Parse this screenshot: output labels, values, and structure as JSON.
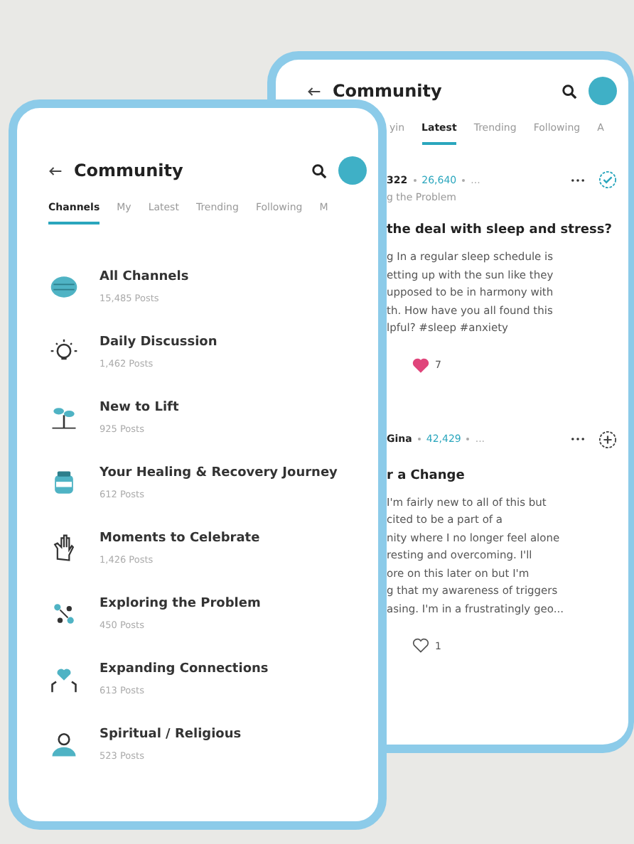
{
  "back_screen": {
    "title": "Community",
    "tabs": [
      {
        "label": "yin",
        "selected": false
      },
      {
        "label": "Latest",
        "selected": true
      },
      {
        "label": "Trending",
        "selected": false
      },
      {
        "label": "Following",
        "selected": false
      },
      {
        "label": "A",
        "selected": false
      }
    ],
    "posts": [
      {
        "author": "322",
        "points": "26,640",
        "time": "...",
        "category": "g the Problem",
        "title": "the deal with sleep and stress?",
        "body": [
          "g In a regular sleep schedule is",
          "etting up with the sun like they",
          "upposed to be in harmony with",
          "th. How have you all found this",
          "lpful? #sleep #anxiety"
        ],
        "liked": true,
        "likes": "7",
        "following": true
      },
      {
        "author": "Gina",
        "points": "42,429",
        "time": "...",
        "title": "r a Change",
        "body": [
          "I'm fairly new to all of this but",
          "cited to be a part of a",
          "nity where I no longer feel alone",
          "resting and overcoming. I'll",
          "ore on this later on but I'm",
          "g that my awareness of triggers",
          "asing. I'm in a frustratingly geo..."
        ],
        "liked": false,
        "likes": "1",
        "following": false
      }
    ]
  },
  "front_screen": {
    "title": "Community",
    "tabs": [
      {
        "label": "Channels",
        "selected": true
      },
      {
        "label": "My",
        "selected": false
      },
      {
        "label": "Latest",
        "selected": false
      },
      {
        "label": "Trending",
        "selected": false
      },
      {
        "label": "Following",
        "selected": false
      },
      {
        "label": "M",
        "selected": false
      }
    ],
    "channels": [
      {
        "kind": "globe",
        "name": "All Channels",
        "posts": "15,485 Posts"
      },
      {
        "kind": "bulb",
        "name": "Daily Discussion",
        "posts": "1,462 Posts"
      },
      {
        "kind": "sprout",
        "name": "New to Lift",
        "posts": "925 Posts"
      },
      {
        "kind": "jar",
        "name": "Your Healing & Recovery Journey",
        "posts": "612 Posts"
      },
      {
        "kind": "hand",
        "name": "Moments to Celebrate",
        "posts": "1,426 Posts"
      },
      {
        "kind": "dots",
        "name": "Exploring the Problem",
        "posts": "450 Posts"
      },
      {
        "kind": "heart",
        "name": "Expanding Connections",
        "posts": "613 Posts"
      },
      {
        "kind": "person",
        "name": "Spiritual / Religious",
        "posts": "523 Posts"
      }
    ]
  }
}
